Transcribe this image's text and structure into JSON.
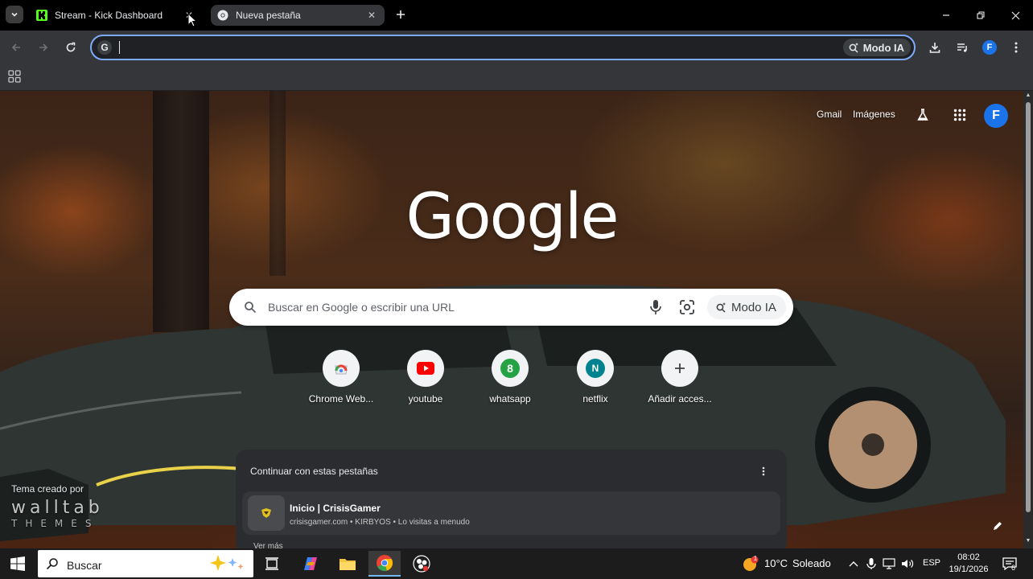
{
  "browser": {
    "tabs": [
      {
        "title": "Stream - Kick Dashboard",
        "active": false
      },
      {
        "title": "Nueva pestaña",
        "active": true
      }
    ],
    "omnibox": {
      "value": "",
      "placeholder": "",
      "ai_mode_label": "Modo IA"
    },
    "profile_initial": "F",
    "accent_color": "#7cacf8"
  },
  "ntp": {
    "header_links": {
      "gmail": "Gmail",
      "images": "Imágenes"
    },
    "profile_initial": "F",
    "logo_text": "Google",
    "search": {
      "value": "",
      "placeholder": "Buscar en Google o escribir una URL",
      "ai_mode_label": "Modo IA"
    },
    "shortcuts": [
      {
        "label": "Chrome Web...",
        "icon": "chrome-webstore-icon"
      },
      {
        "label": "youtube",
        "icon": "youtube-icon"
      },
      {
        "label": "whatsapp",
        "icon": "whatsapp-icon",
        "glyph": "8"
      },
      {
        "label": "netflix",
        "icon": "netflix-icon",
        "glyph": "N"
      },
      {
        "label": "Añadir acces...",
        "icon": "plus-icon"
      }
    ],
    "continue_card": {
      "title": "Continuar con estas pestañas",
      "item": {
        "title": "Inicio | CrisisGamer",
        "subtitle": "crisisgamer.com • KIRBYOS • Lo visitas a menudo"
      },
      "more_label": "Ver más"
    },
    "theme_credit": {
      "label": "Tema creado por",
      "brand": "walltab",
      "brand_sub": "THEMES"
    }
  },
  "taskbar": {
    "search_placeholder": "Buscar",
    "weather": {
      "temp": "10°C",
      "condition": "Soleado",
      "badge": "1"
    },
    "language": "ESP",
    "time": "08:02",
    "date": "19/1/2026",
    "notifications": "6"
  }
}
